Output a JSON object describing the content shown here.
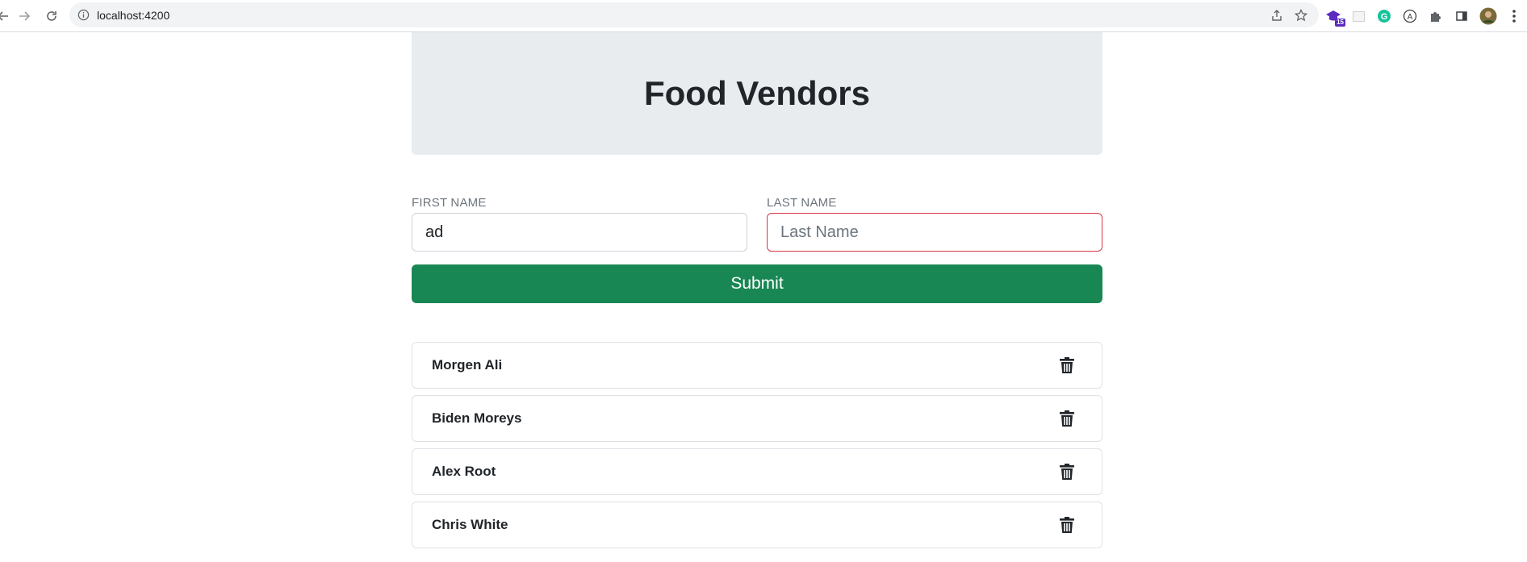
{
  "browser": {
    "url": "localhost:4200",
    "extensions": [
      {
        "icon": "graduation-cap-extension-icon",
        "badge": "15",
        "color": "#5b2bc0"
      },
      {
        "icon": "blank-extension-icon"
      },
      {
        "icon": "grammarly-extension-icon",
        "color": "#15c39a"
      },
      {
        "icon": "a-circle-extension-icon"
      },
      {
        "icon": "puzzle-extensions-icon"
      },
      {
        "icon": "side-panel-icon"
      },
      {
        "icon": "profile-avatar"
      },
      {
        "icon": "kebab-menu-icon"
      }
    ]
  },
  "header": {
    "title": "Food Vendors",
    "background": "#e9ecef"
  },
  "form": {
    "first_name_label": "FIRST NAME",
    "first_name_value": "ad",
    "last_name_label": "LAST NAME",
    "last_name_placeholder": "Last Name",
    "last_name_value": "",
    "submit_label": "Submit",
    "submit_color": "#198754",
    "invalid_border_color": "#dc3545"
  },
  "vendors": [
    {
      "name": "Morgen Ali"
    },
    {
      "name": "Biden Moreys"
    },
    {
      "name": "Alex Root"
    },
    {
      "name": "Chris White"
    }
  ]
}
